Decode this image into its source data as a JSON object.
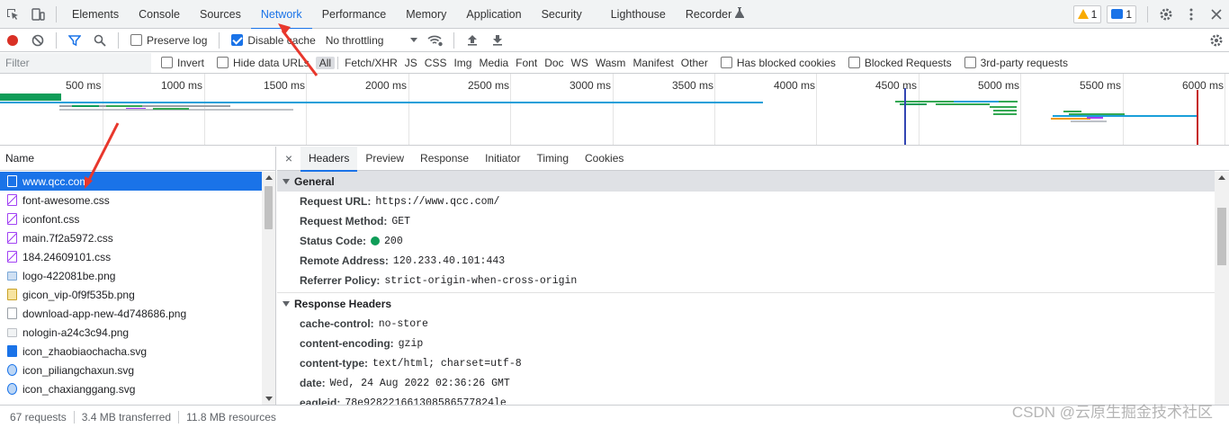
{
  "tabs": [
    "Elements",
    "Console",
    "Sources",
    "Network",
    "Performance",
    "Memory",
    "Application",
    "Security",
    "Lighthouse",
    "Recorder"
  ],
  "active_tab": "Network",
  "issues": {
    "warnings": "1",
    "messages": "1"
  },
  "toolbar": {
    "preserve_log": "Preserve log",
    "disable_cache": "Disable cache",
    "throttling": "No throttling"
  },
  "filter": {
    "placeholder": "Filter",
    "invert": "Invert",
    "hide_data_urls": "Hide data URLs",
    "types": [
      "All",
      "Fetch/XHR",
      "JS",
      "CSS",
      "Img",
      "Media",
      "Font",
      "Doc",
      "WS",
      "Wasm",
      "Manifest",
      "Other"
    ],
    "blocked_cookies": "Has blocked cookies",
    "blocked_requests": "Blocked Requests",
    "third_party": "3rd-party requests"
  },
  "timeline": {
    "ticks": [
      "500 ms",
      "1000 ms",
      "1500 ms",
      "2000 ms",
      "2500 ms",
      "3000 ms",
      "3500 ms",
      "4000 ms",
      "4500 ms",
      "5000 ms",
      "5500 ms",
      "6000 ms"
    ]
  },
  "request_list": {
    "header": "Name",
    "rows": [
      {
        "name": "www.qcc.com",
        "type": "doc"
      },
      {
        "name": "font-awesome.css",
        "type": "css"
      },
      {
        "name": "iconfont.css",
        "type": "css"
      },
      {
        "name": "main.7f2a5972.css",
        "type": "css"
      },
      {
        "name": "184.24609101.css",
        "type": "css"
      },
      {
        "name": "logo-422081be.png",
        "type": "img"
      },
      {
        "name": "gicon_vip-0f9f535b.png",
        "type": "gif"
      },
      {
        "name": "download-app-new-4d748686.png",
        "type": "img"
      },
      {
        "name": "nologin-a24c3c94.png",
        "type": "img"
      },
      {
        "name": "icon_zhaobiaochacha.svg",
        "type": "svg"
      },
      {
        "name": "icon_piliangchaxun.svg",
        "type": "svg"
      },
      {
        "name": "icon_chaxianggang.svg",
        "type": "svg"
      }
    ]
  },
  "status": {
    "requests": "67 requests",
    "transferred": "3.4 MB transferred",
    "resources": "11.8 MB resources"
  },
  "details": {
    "close": "×",
    "tabs": [
      "Headers",
      "Preview",
      "Response",
      "Initiator",
      "Timing",
      "Cookies"
    ],
    "general": {
      "title": "General",
      "fields": [
        {
          "k": "Request URL:",
          "v": "https://www.qcc.com/"
        },
        {
          "k": "Request Method:",
          "v": "GET"
        },
        {
          "k": "Status Code:",
          "v": "200"
        },
        {
          "k": "Remote Address:",
          "v": "120.233.40.101:443"
        },
        {
          "k": "Referrer Policy:",
          "v": "strict-origin-when-cross-origin"
        }
      ]
    },
    "response_headers": {
      "title": "Response Headers",
      "fields": [
        {
          "k": "cache-control:",
          "v": "no-store"
        },
        {
          "k": "content-encoding:",
          "v": "gzip"
        },
        {
          "k": "content-type:",
          "v": "text/html; charset=utf-8"
        },
        {
          "k": "date:",
          "v": "Wed, 24 Aug 2022 02:36:26 GMT"
        },
        {
          "k": "eagleid:",
          "v": "78e928221661308586577824le"
        }
      ]
    }
  },
  "watermark": "CSDN @云原生掘金技术社区",
  "colors": {
    "accent": "#1a73e8",
    "record": "#d93025",
    "status_ok": "#0f9d58",
    "arrow": "#e8372c"
  }
}
